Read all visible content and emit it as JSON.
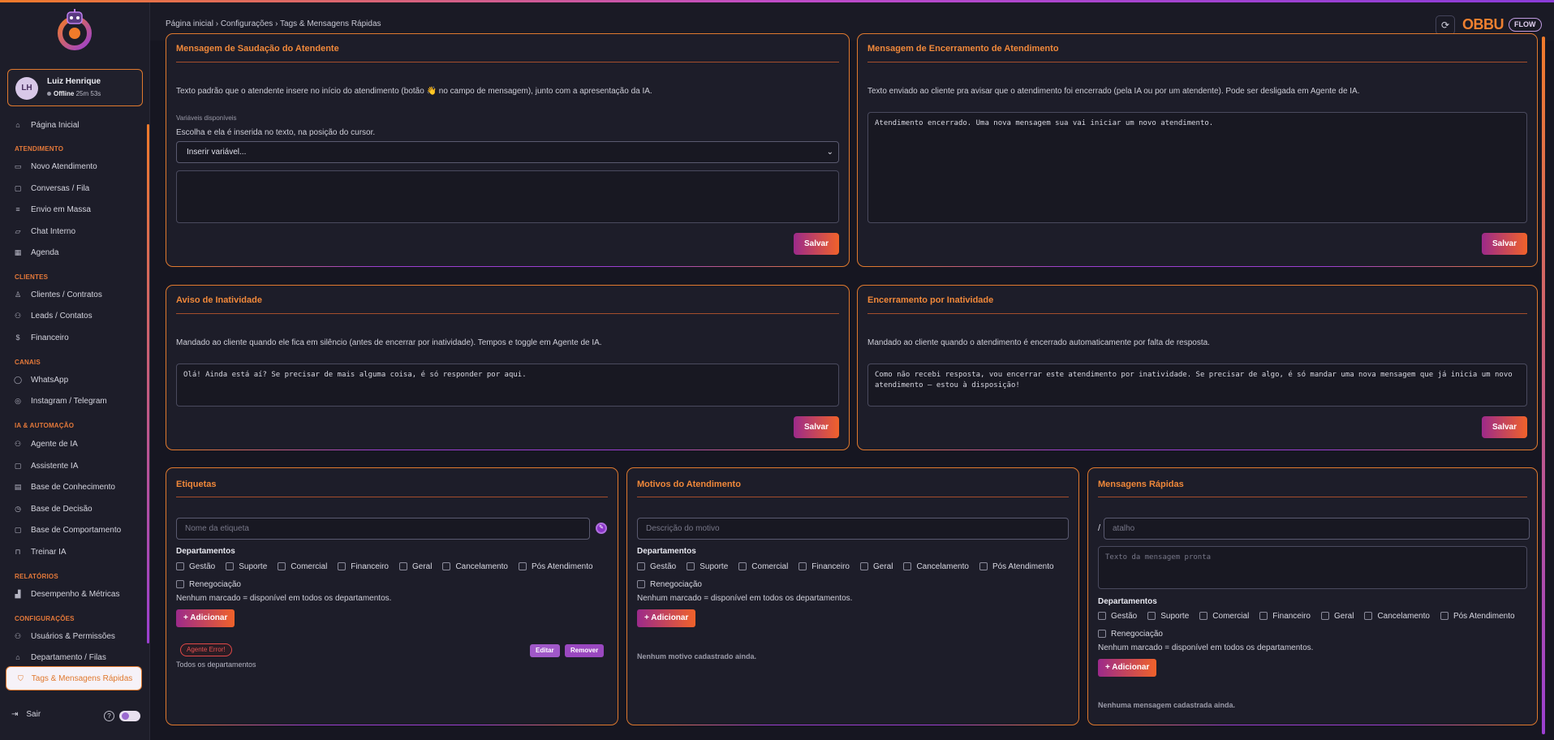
{
  "sidebar": {
    "user": {
      "initials": "LH",
      "name": "Luiz Henrique",
      "status": "Offline",
      "duration": "25m 53s"
    },
    "home": "Página Inicial",
    "sections": {
      "atendimento": "ATENDIMENTO",
      "clientes": "CLIENTES",
      "canais": "CANAIS",
      "ia": "IA & AUTOMAÇÃO",
      "relatorios": "RELATÓRIOS",
      "config": "CONFIGURAÇÕES"
    },
    "items": {
      "novo_atendimento": "Novo Atendimento",
      "conversas": "Conversas / Fila",
      "envio_massa": "Envio em Massa",
      "chat_interno": "Chat Interno",
      "agenda": "Agenda",
      "clientes_contratos": "Clientes / Contratos",
      "leads": "Leads / Contatos",
      "financeiro": "Financeiro",
      "whatsapp": "WhatsApp",
      "instagram": "Instagram / Telegram",
      "agente_ia": "Agente de IA",
      "assistente_ia": "Assistente IA",
      "base_conhecimento": "Base de Conhecimento",
      "base_decisao": "Base de Decisão",
      "base_comportamento": "Base de Comportamento",
      "treinar_ia": "Treinar IA",
      "desempenho": "Desempenho & Métricas",
      "usuarios": "Usuários & Permissões",
      "departamento": "Departamento / Filas",
      "tags": "Tags & Mensagens Rápidas"
    },
    "logout": "Sair",
    "help": "?"
  },
  "header": {
    "breadcrumb": "Página inicial › Configurações › Tags & Mensagens Rápidas",
    "refresh": "⟳",
    "brand": "OBBU",
    "brand_flow": "FLOW"
  },
  "saudacao": {
    "title": "Mensagem de Saudação do Atendente",
    "desc": "Texto padrão que o atendente insere no início do atendimento (botão 👋 no campo de mensagem), junto com a apresentação da IA.",
    "vars_label": "Variáveis disponíveis",
    "vars_hint": "Escolha e ela é inserida no texto, na posição do cursor.",
    "select_value": "Inserir variável...",
    "text": "",
    "save": "Salvar"
  },
  "encerramento": {
    "title": "Mensagem de Encerramento de Atendimento",
    "desc": "Texto enviado ao cliente pra avisar que o atendimento foi encerrado (pela IA ou por um atendente). Pode ser desligada em Agente de IA.",
    "text": "Atendimento encerrado. Uma nova mensagem sua vai iniciar um novo atendimento.",
    "save": "Salvar"
  },
  "inatividade": {
    "title": "Aviso de Inatividade",
    "desc": "Mandado ao cliente quando ele fica em silêncio (antes de encerrar por inatividade). Tempos e toggle em Agente de IA.",
    "text": "Olá! Ainda está aí? Se precisar de mais alguma coisa, é só responder por aqui.",
    "save": "Salvar"
  },
  "encerramento_inatividade": {
    "title": "Encerramento por Inatividade",
    "desc": "Mandado ao cliente quando o atendimento é encerrado automaticamente por falta de resposta.",
    "text": "Como não recebi resposta, vou encerrar este atendimento por inatividade. Se precisar de algo, é só mandar uma nova mensagem que já inicia um novo atendimento — estou à disposição!",
    "save": "Salvar"
  },
  "departments": [
    "Gestão",
    "Suporte",
    "Comercial",
    "Financeiro",
    "Geral",
    "Cancelamento",
    "Pós Atendimento",
    "Renegociação"
  ],
  "etiquetas": {
    "title": "Etiquetas",
    "placeholder": "Nome da etiqueta",
    "dept_label": "Departamentos",
    "hint": "Nenhum marcado = disponível em todos os departamentos.",
    "add": "+ Adicionar",
    "tag_name": "Agente Error!",
    "tag_scope": "Todos os departamentos",
    "edit": "Editar",
    "remove": "Remover",
    "tag_color": "#e04848"
  },
  "motivos": {
    "title": "Motivos do Atendimento",
    "placeholder": "Descrição do motivo",
    "dept_label": "Departamentos",
    "hint": "Nenhum marcado = disponível em todos os departamentos.",
    "add": "+ Adicionar",
    "empty": "Nenhum motivo cadastrado ainda."
  },
  "rapidas": {
    "title": "Mensagens Rápidas",
    "slash": "/",
    "shortcut_placeholder": "atalho",
    "message_placeholder": "Texto da mensagem pronta",
    "dept_label": "Departamentos",
    "hint": "Nenhum marcado = disponível em todos os departamentos.",
    "add": "+ Adicionar",
    "empty": "Nenhuma mensagem cadastrada ainda."
  },
  "colors": {
    "accent": "#f0883a",
    "purple": "#9b3fd1",
    "bg": "#161621"
  }
}
